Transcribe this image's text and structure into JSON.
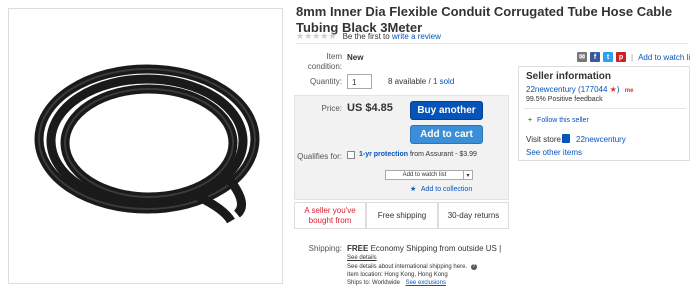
{
  "product": {
    "title": "8mm Inner Dia Flexible Conduit Corrugated Tube Hose Cable Tubing Black 3Meter",
    "rating_text": "Be the first to",
    "review_link": "write a review"
  },
  "share": {
    "icons": [
      "email-icon",
      "facebook-icon",
      "twitter-icon",
      "pinterest-icon"
    ],
    "watch_link": "Add to watch list"
  },
  "details": {
    "condition_label": "Item condition:",
    "condition_value": "New",
    "quantity_label": "Quantity:",
    "quantity_value": "1",
    "available": "8 available",
    "sold": "1 sold"
  },
  "purchase": {
    "price_label": "Price:",
    "price": "US $4.85",
    "buy_button": "Buy another",
    "cart_button": "Add to cart",
    "qualifies_label": "Qualifies for:",
    "protection_link": "1-yr protection",
    "protection_rest": "from Assurant - $3.99",
    "watch_button": "Add to watch list",
    "collection_link": "Add to collection"
  },
  "features": {
    "seller_bought": "A seller you've bought from",
    "shipping": "Free shipping",
    "returns": "30-day returns"
  },
  "shipping": {
    "label": "Shipping:",
    "free": "FREE",
    "desc": "Economy Shipping from outside US |",
    "see_details": "See details",
    "intl_note": "See details about international shipping here.",
    "item_location": "Item location:  Hong Kong, Hong Kong",
    "ships_to_label": "Ships to:  Worldwide",
    "exclusions_link": "See exclusions"
  },
  "seller": {
    "title": "Seller information",
    "name": "22newcentury",
    "feedback_count": "177044",
    "badge": "me",
    "positive": "99.5% Positive feedback",
    "follow": "Follow this seller",
    "store_label": "Visit store:",
    "store_name": "22newcentury",
    "other_items": "See other items"
  },
  "colors": {
    "link": "#0654ba",
    "buy_button": "#0654ba",
    "cart_button": "#3a8fd8",
    "alert_red": "#dd1e31"
  }
}
